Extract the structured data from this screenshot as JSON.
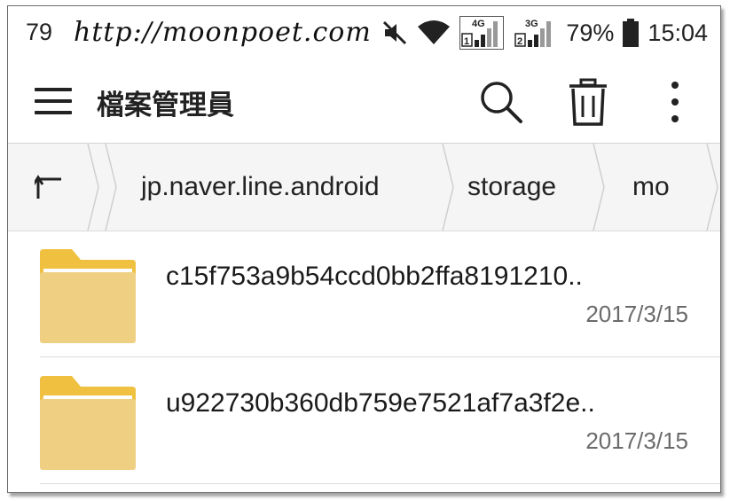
{
  "status_bar": {
    "notification_count": "79",
    "watermark": "http://moonpoet.com",
    "network1": "4G",
    "network2": "3G",
    "sim1": "1",
    "sim2": "2",
    "battery": "79%",
    "time": "15:04",
    "icons": [
      "mute-icon",
      "wifi-icon",
      "signal-4g-icon",
      "signal-3g-icon",
      "battery-icon"
    ]
  },
  "app_bar": {
    "title": "檔案管理員",
    "actions": [
      "search-icon",
      "trash-icon",
      "more-vert-icon"
    ]
  },
  "breadcrumb": {
    "up_icon": "up-arrow-icon",
    "items": [
      "jp.naver.line.android",
      "storage",
      "mo"
    ]
  },
  "files": [
    {
      "name": "c15f753a9b54ccd0bb2ffa8191210..",
      "date": "2017/3/15",
      "icon": "folder-icon"
    },
    {
      "name": "u922730b360db759e7521af7a3f2e..",
      "date": "2017/3/15",
      "icon": "folder-icon"
    }
  ],
  "colors": {
    "folder_tab": "#f0c040",
    "folder_body": "#efd083",
    "text": "#1a1a1a",
    "date": "#6b6b6b"
  }
}
